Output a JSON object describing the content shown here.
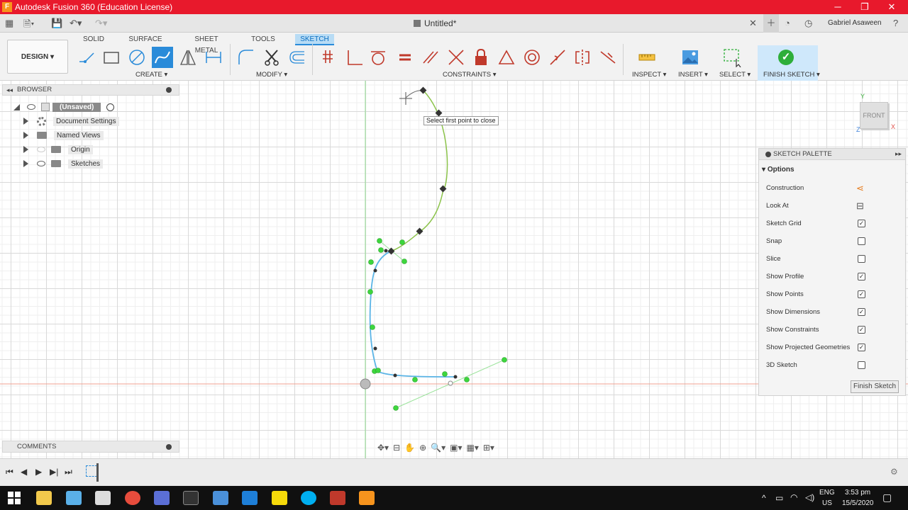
{
  "window": {
    "title": "Autodesk Fusion 360 (Education License)",
    "app_icon_letter": "F"
  },
  "tabbar": {
    "document": "Untitled*",
    "user": "Gabriel Asaween"
  },
  "workspace_tabs": [
    "SOLID",
    "SURFACE",
    "SHEET METAL",
    "TOOLS",
    "SKETCH"
  ],
  "design_button": "DESIGN ▾",
  "toolbar_groups": {
    "create": "CREATE ▾",
    "modify": "MODIFY ▾",
    "constraints": "CONSTRAINTS ▾",
    "inspect": "INSPECT ▾",
    "insert": "INSERT ▾",
    "select": "SELECT ▾",
    "finish": "FINISH SKETCH ▾"
  },
  "browser": {
    "header": "BROWSER",
    "root": "(Unsaved)",
    "items": [
      {
        "label": "Document Settings"
      },
      {
        "label": "Named Views"
      },
      {
        "label": "Origin"
      },
      {
        "label": "Sketches"
      }
    ]
  },
  "comments": "COMMENTS",
  "tooltip": "Select first point to close",
  "viewcube": {
    "face": "FRONT",
    "x_axis": "X",
    "y_axis": "Y",
    "z_axis": "Z"
  },
  "palette": {
    "header": "SKETCH PALETTE",
    "section": "Options",
    "rows": [
      {
        "label": "Construction",
        "kind": "icon"
      },
      {
        "label": "Look At",
        "kind": "icon"
      },
      {
        "label": "Sketch Grid",
        "checked": true
      },
      {
        "label": "Snap",
        "checked": false
      },
      {
        "label": "Slice",
        "checked": false
      },
      {
        "label": "Show Profile",
        "checked": true
      },
      {
        "label": "Show Points",
        "checked": true
      },
      {
        "label": "Show Dimensions",
        "checked": true
      },
      {
        "label": "Show Constraints",
        "checked": true
      },
      {
        "label": "Show Projected Geometries",
        "checked": true
      },
      {
        "label": "3D Sketch",
        "checked": false
      }
    ],
    "finish_button": "Finish Sketch"
  },
  "taskbar": {
    "lang": "ENG",
    "region": "US",
    "time": "3:53 pm",
    "date": "15/5/2020"
  },
  "colors": {
    "title_red": "#e8192c",
    "accent_blue": "#2a8bd9",
    "spline_blue": "#5ab4e6",
    "spline_green": "#8bc34a",
    "point_green": "#3dd63d"
  }
}
